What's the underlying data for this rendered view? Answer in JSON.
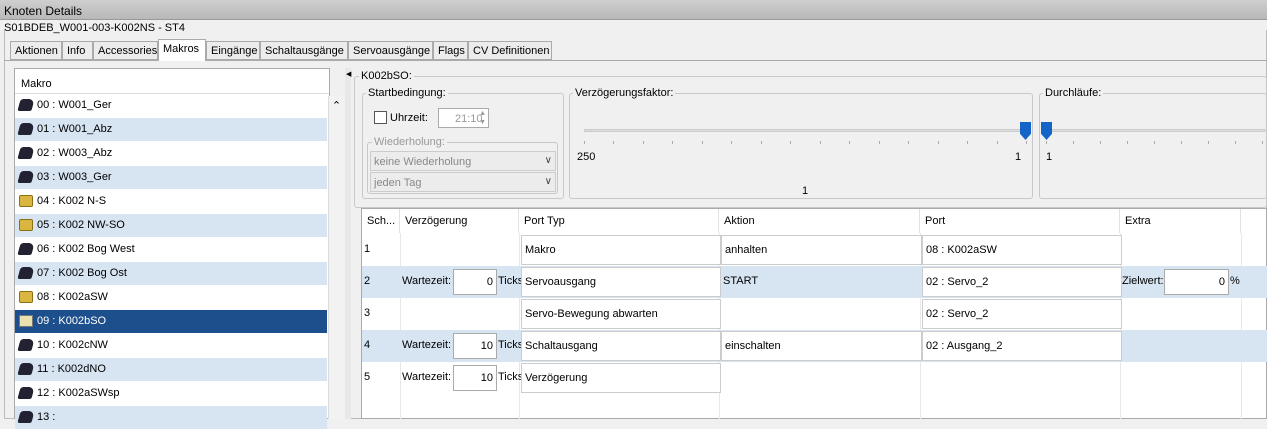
{
  "window": {
    "title": "Knoten Details",
    "node": "S01BDEB_W001-003-K002NS - ST4"
  },
  "tabs": [
    "Aktionen",
    "Info",
    "Accessories",
    "Makros",
    "Eingänge",
    "Schaltausgänge",
    "Servoausgänge",
    "Flags",
    "CV Definitionen"
  ],
  "selected_tab": "Makros",
  "list": {
    "header": "Makro",
    "items": [
      {
        "label": "00 : W001_Ger",
        "icon": "train-icon"
      },
      {
        "label": "01 : W001_Abz",
        "icon": "train-icon"
      },
      {
        "label": "02 : W003_Abz",
        "icon": "train-icon"
      },
      {
        "label": "03 : W003_Ger",
        "icon": "train-icon"
      },
      {
        "label": "04 : K002 N-S",
        "icon": "lock-icon"
      },
      {
        "label": "05 : K002 NW-SO",
        "icon": "lock-icon"
      },
      {
        "label": "06 : K002 Bog West",
        "icon": "train-icon"
      },
      {
        "label": "07 : K002 Bog Ost",
        "icon": "train-icon"
      },
      {
        "label": "08 : K002aSW",
        "icon": "lock-icon"
      },
      {
        "label": "09 : K002bSO",
        "icon": "edit-icon"
      },
      {
        "label": "10 : K002cNW",
        "icon": "train-icon"
      },
      {
        "label": "11 : K002dNO",
        "icon": "train-icon"
      },
      {
        "label": "12 : K002aSWsp",
        "icon": "train-icon"
      },
      {
        "label": "13 :",
        "icon": "train-icon"
      }
    ],
    "selected_index": 9
  },
  "detail": {
    "title": "K002bSO:",
    "start": {
      "label": "Startbedingung:",
      "time_label": "Uhrzeit:",
      "time_value": "21:10",
      "repeat_label": "Wiederholung:",
      "repeat_value": "keine Wiederholung",
      "day_value": "jeden Tag"
    },
    "delay": {
      "label": "Verzögerungsfaktor:",
      "min": "250",
      "max": "1",
      "value": "1",
      "level": 1.0
    },
    "runs": {
      "label": "Durchläufe:",
      "min": "1",
      "level": 0.0
    }
  },
  "grid": {
    "headers": [
      "Sch...",
      "Verzögerung",
      "Port Typ",
      "Aktion",
      "Port",
      "Extra"
    ],
    "rows": [
      {
        "n": "1",
        "wait_label": "",
        "wait": "",
        "unit": "",
        "type": "Makro",
        "action": "anhalten",
        "action_combo": true,
        "port": "08 : K002aSW",
        "extra_label": "",
        "extra": "",
        "extra_unit": ""
      },
      {
        "n": "2",
        "wait_label": "Wartezeit:",
        "wait": "0",
        "unit": "Ticks",
        "type": "Servoausgang",
        "action": "START",
        "action_combo": false,
        "port": "02 : Servo_2",
        "extra_label": "Zielwert:",
        "extra": "0",
        "extra_unit": "%"
      },
      {
        "n": "3",
        "wait_label": "",
        "wait": "",
        "unit": "",
        "type": "Servo-Bewegung abwarten",
        "action": "",
        "action_combo": false,
        "port": "02 : Servo_2",
        "extra_label": "",
        "extra": "",
        "extra_unit": ""
      },
      {
        "n": "4",
        "wait_label": "Wartezeit:",
        "wait": "10",
        "unit": "Ticks",
        "type": "Schaltausgang",
        "action": "einschalten",
        "action_combo": true,
        "port": "02 : Ausgang_2",
        "extra_label": "",
        "extra": "",
        "extra_unit": ""
      },
      {
        "n": "5",
        "wait_label": "Wartezeit:",
        "wait": "10",
        "unit": "Ticks",
        "type": "Verzögerung",
        "action": "",
        "action_combo": false,
        "port": "",
        "extra_label": "",
        "extra": "",
        "extra_unit": ""
      }
    ]
  }
}
